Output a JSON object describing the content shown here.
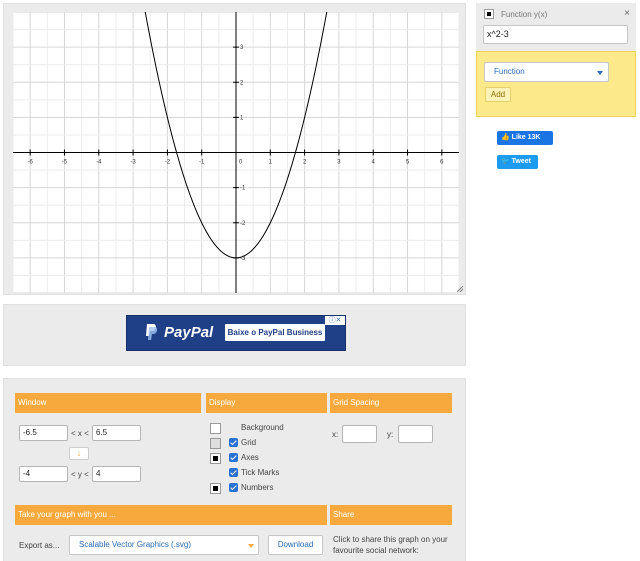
{
  "graph": {
    "x_ticks": [
      "-6",
      "-5",
      "-4",
      "-3",
      "-2",
      "-1",
      "0",
      "1",
      "2",
      "3",
      "4",
      "5",
      "6"
    ],
    "y_ticks": [
      "3",
      "2",
      "1",
      "-1",
      "-2",
      "-3"
    ],
    "curve_function": "x^2-3",
    "curve_color": "#000000",
    "window": {
      "xmin": -6.5,
      "xmax": 6.5,
      "ymin": -4,
      "ymax": 4
    }
  },
  "ad": {
    "brand": "PayPal",
    "cta": "Baixe o PayPal Business",
    "badge": "ⓘ✕"
  },
  "window_section": {
    "header": "Window",
    "xmin": "-6.5",
    "x_between": "< x <",
    "xmax": "6.5",
    "ymin": "-4",
    "y_between": "< y <",
    "ymax": "4",
    "swap_icon": "↓"
  },
  "display_section": {
    "header": "Display",
    "options": [
      {
        "label": "Background",
        "checked": false
      },
      {
        "label": "Grid",
        "checked": true
      },
      {
        "label": "Axes",
        "checked": true
      },
      {
        "label": "Tick Marks",
        "checked": true
      },
      {
        "label": "Numbers",
        "checked": true
      }
    ]
  },
  "grid_spacing": {
    "header": "Grid Spacing",
    "x_label": "x:",
    "y_label": "y:",
    "x_value": "",
    "y_value": ""
  },
  "export_section": {
    "header": "Take your graph with you ...",
    "export_label": "Export as...",
    "format": "Scalable Vector Graphics (.svg)",
    "download": "Download"
  },
  "share_section": {
    "header": "Share",
    "text": "Click to share this graph on your favourite social network:"
  },
  "function_card": {
    "title": "Function y(x)",
    "expression": "x^2-3",
    "close": "×"
  },
  "add_card": {
    "type": "Function",
    "add_label": "Add"
  },
  "social": {
    "like_label": "Like 13K",
    "tweet_label": "Tweet"
  },
  "colors": {
    "accent": "#f7a93d",
    "link_blue": "#2a6cb8",
    "panel_gray": "#ebebeb",
    "add_yellow": "#fbe98a"
  }
}
